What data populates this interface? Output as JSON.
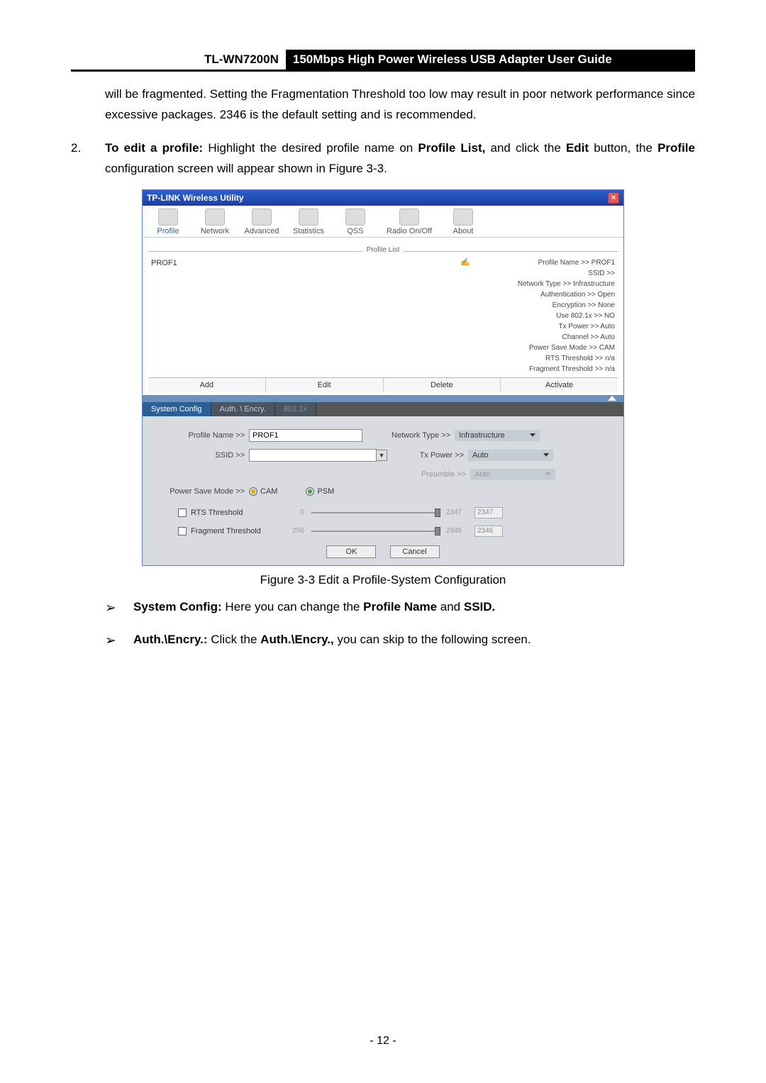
{
  "header": {
    "model": "TL-WN7200N",
    "title": "150Mbps High Power Wireless USB Adapter User Guide"
  },
  "body": {
    "frag_para": "will be fragmented. Setting the Fragmentation Threshold too low may result in poor network performance since excessive packages. 2346 is the default setting and is recommended.",
    "item2_num": "2.",
    "item2_a": "To edit a profile:",
    "item2_b": " Highlight the desired profile name on ",
    "item2_c": "Profile List,",
    "item2_d": " and click the ",
    "item2_e": "Edit",
    "item2_f": " button, the ",
    "item2_g": "Profile",
    "item2_h": " configuration screen will appear shown in Figure 3-3."
  },
  "app": {
    "title": "TP-LINK Wireless Utility",
    "nav": [
      "Profile",
      "Network",
      "Advanced",
      "Statistics",
      "QSS",
      "Radio On/Off",
      "About"
    ],
    "profile_list_label": "Profile List",
    "profile_entry": "PROF1",
    "details": {
      "profile_name": "Profile Name >> PROF1",
      "ssid": "SSID >>",
      "net_type": "Network Type >> Infrastructure",
      "auth": "Authentication >> Open",
      "encr": "Encryption >> None",
      "use8021x": "Use 802.1x >> NO",
      "txpower": "Tx Power >> Auto",
      "channel": "Channel >> Auto",
      "psm": "Power Save Mode >> CAM",
      "rts": "RTS Threshold >> n/a",
      "frag": "Fragment Threshold >> n/a"
    },
    "actions": [
      "Add",
      "Edit",
      "Delete",
      "Activate"
    ],
    "tabs": [
      "System Config",
      "Auth. \\ Encry.",
      "802.1x"
    ],
    "config": {
      "profile_name_label": "Profile Name >>",
      "profile_name_value": "PROF1",
      "ssid_label": "SSID >>",
      "ssid_value": "",
      "net_type_label": "Network Type >>",
      "net_type_value": "Infrastructure",
      "txpower_label": "Tx Power >>",
      "txpower_value": "Auto",
      "preamble_label": "Preamble >>",
      "preamble_value": "Auto",
      "psm_label": "Power Save Mode >>",
      "cam": "CAM",
      "psm": "PSM",
      "rts_label": "RTS Threshold",
      "rts_min": "0",
      "rts_max": "2347",
      "rts_val": "2347",
      "frag_label": "Fragment Threshold",
      "frag_min": "256",
      "frag_max": "2346",
      "frag_val": "2346",
      "ok": "OK",
      "cancel": "Cancel"
    }
  },
  "caption": "Figure 3-3 Edit a Profile-System Configuration",
  "bullets": {
    "b1a": "System Config:",
    "b1b": " Here you can change the ",
    "b1c": "Profile Name",
    "b1d": " and ",
    "b1e": "SSID.",
    "b2a": "Auth.\\Encry.:",
    "b2b": " Click the ",
    "b2c": "Auth.\\Encry.,",
    "b2d": " you can skip to the following screen."
  },
  "page_num": "- 12 -"
}
